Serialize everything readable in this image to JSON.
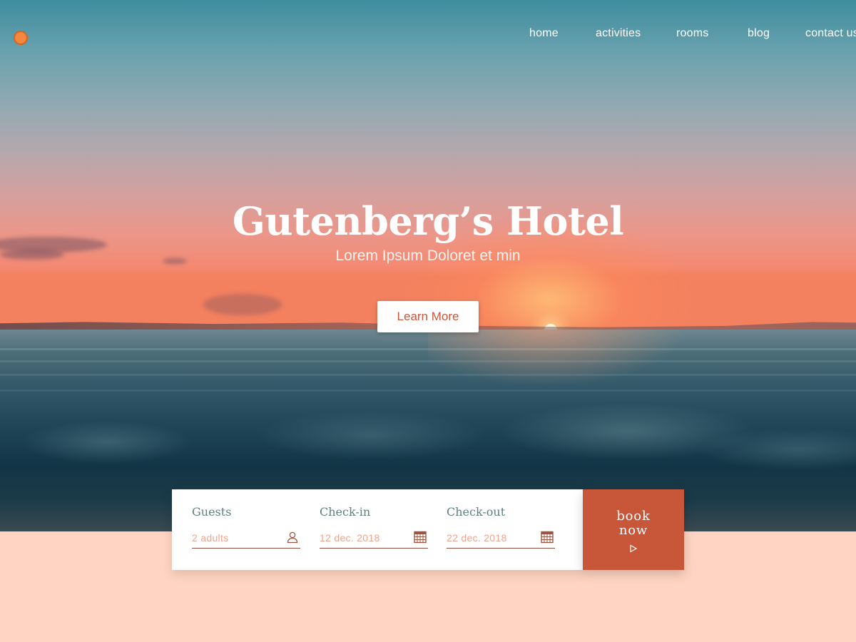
{
  "nav": {
    "items": [
      {
        "label": "home"
      },
      {
        "label": "activities"
      },
      {
        "label": "rooms"
      },
      {
        "label": "blog"
      },
      {
        "label": "contact us"
      }
    ]
  },
  "hero": {
    "title": "Gutenberg’s Hotel",
    "subtitle": "Lorem Ipsum Doloret et min",
    "cta_label": "Learn More"
  },
  "booking": {
    "guests": {
      "label": "Guests",
      "value": "2 adults",
      "icon": "user-icon"
    },
    "checkin": {
      "label": "Check-in",
      "value": "12 dec. 2018",
      "icon": "calendar-icon"
    },
    "checkout": {
      "label": "Check-out",
      "value": "22 dec. 2018",
      "icon": "calendar-icon"
    },
    "book_label_line1": "book",
    "book_label_line2": "now"
  },
  "colors": {
    "accent": "#c85638",
    "logo": "#f5883f",
    "background": "#ffd4c2",
    "label_text": "#5f7f80",
    "input_text": "#efa58d"
  }
}
